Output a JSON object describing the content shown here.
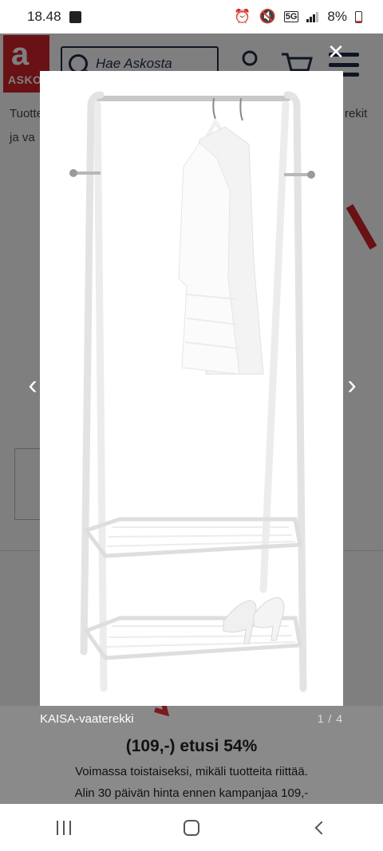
{
  "status_bar": {
    "time": "18.48",
    "network": "5G",
    "battery": "8%",
    "battery_level": 0.08
  },
  "page": {
    "logo_text": "ASKO",
    "search_placeholder": "Hae Askosta",
    "text_line1_start": "Tuotte",
    "text_line1_end": "rekit",
    "text_line2": "ja va"
  },
  "modal": {
    "close_icon": "close-icon",
    "product_name": "KAISA-vaaterekki",
    "image_counter": "1 / 4",
    "price_line": "(109,-) etusi 54%",
    "note_validity": "Voimassa toistaiseksi, mikäli tuotteita riittää.",
    "note_lowest": "Alin 30 päivän hinta ennen kampanjaa 109,-"
  },
  "colors": {
    "brand_red": "#d2232a",
    "navy": "#1d2d4a",
    "overlay": "rgba(0,0,0,0.5)"
  }
}
